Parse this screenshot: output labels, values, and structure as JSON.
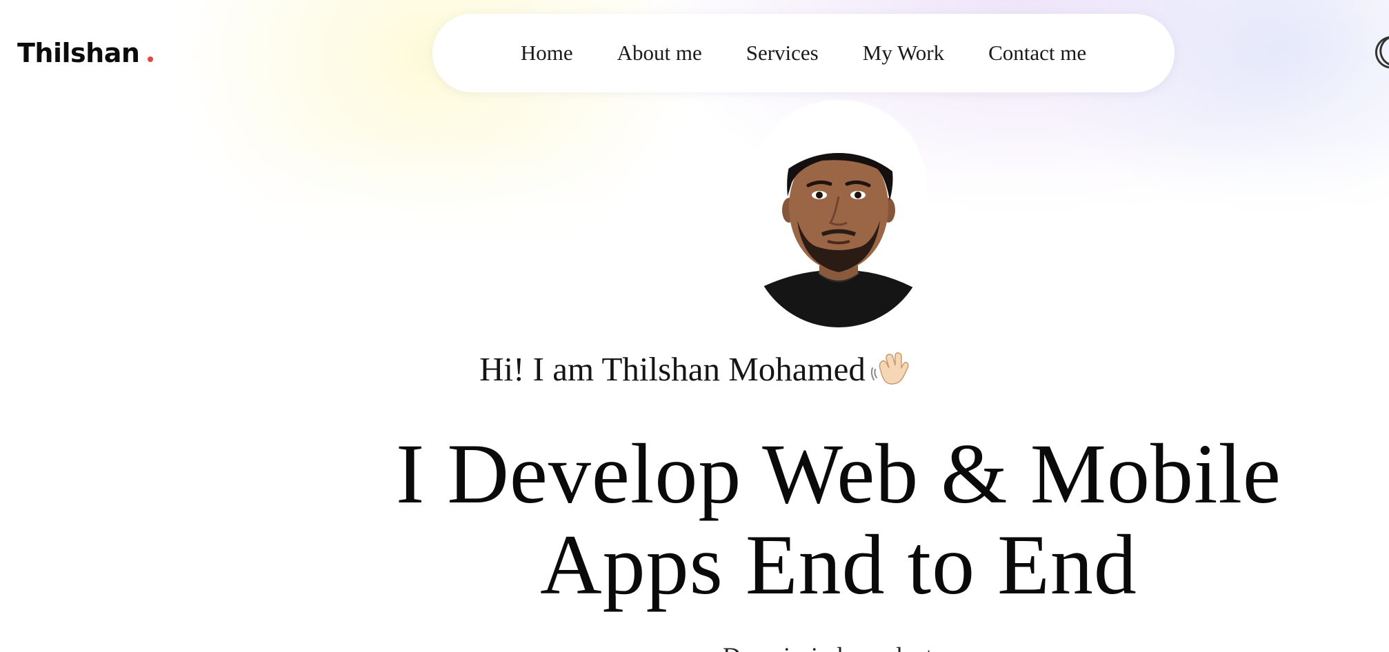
{
  "brand": {
    "name": "Thilshan",
    "dot_color": "#e0483c"
  },
  "nav": {
    "items": [
      {
        "label": "Home"
      },
      {
        "label": "About me"
      },
      {
        "label": "Services"
      },
      {
        "label": "My Work"
      },
      {
        "label": "Contact me"
      }
    ]
  },
  "theme_toggle": {
    "icon": "moon-icon"
  },
  "hero": {
    "avatar_icon": "profile-photo",
    "greeting": "Hi! I am Thilshan Mohamed",
    "greeting_emoji": "waving-hand-icon",
    "headline_line1": "I Develop Web & Mobile",
    "headline_line2": "Apps End to End",
    "subtitle": "Domain-independent"
  },
  "colors": {
    "text": "#111111",
    "nav_bg": "#ffffff",
    "accent_dot": "#e0483c",
    "glow_yellow": "#fdfad7",
    "glow_purple": "#ece0f8"
  }
}
